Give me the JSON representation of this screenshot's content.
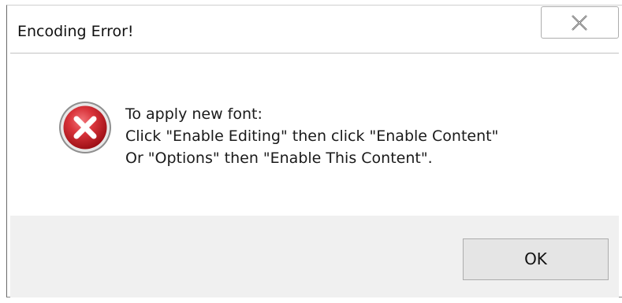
{
  "window": {
    "title": "Encoding Error!",
    "close_icon": "close-x-icon"
  },
  "message": {
    "icon": "error-icon",
    "lines": [
      "To apply new font:",
      "Click \"Enable Editing\" then click \"Enable Content\"",
      "Or \"Options\" then \"Enable This Content\"."
    ]
  },
  "buttons": {
    "ok_label": "OK"
  },
  "colors": {
    "error_red": "#c8232c",
    "button_bar_bg": "#f0f0f0",
    "button_bg": "#e5e5e5"
  }
}
